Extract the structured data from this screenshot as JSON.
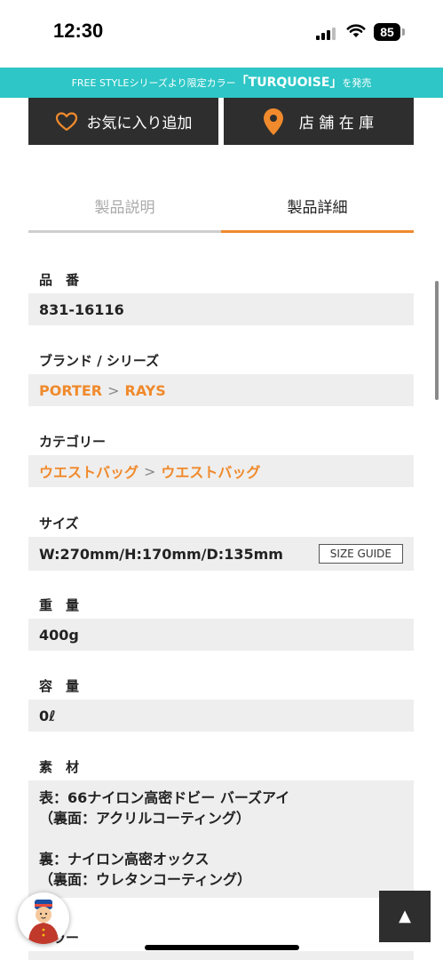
{
  "status": {
    "time": "12:30",
    "battery": "85"
  },
  "banner": {
    "prefix": "FREE STYLEシリーズより限定カラー",
    "highlight": "「TURQUOISE」",
    "suffix": "を発売",
    "color": "#2ec6c6"
  },
  "actions": {
    "favorite_label": "お気に入り追加",
    "store_label": "店 舗 在 庫",
    "accent": "#f08a2c"
  },
  "tabs": [
    {
      "label": "製品説明"
    },
    {
      "label": "製品詳細",
      "active": true
    }
  ],
  "specs": {
    "item_number": {
      "label": "品　番",
      "value": "831-16116"
    },
    "brand": {
      "label": "ブランド / シリーズ",
      "brand": "PORTER",
      "separator": ">",
      "series": "RAYS"
    },
    "category": {
      "label": "カテゴリー",
      "parent": "ウエストバッグ",
      "separator": ">",
      "child": "ウエストバッグ"
    },
    "size": {
      "label": "サイズ",
      "value": "W:270mm/H:170mm/D:135mm",
      "guide_label": "SIZE GUIDE"
    },
    "weight": {
      "label": "重　量",
      "value": "400g"
    },
    "capacity": {
      "label": "容　量",
      "value": "0ℓ"
    },
    "material": {
      "label": "素　材",
      "line1": "表：66ナイロン高密ドビー バーズアイ",
      "line2": "（裏面：アクリルコーティング）",
      "line3": "裏：ナイロン高密オックス",
      "line4": "（裏面：ウレタンコーティング）"
    },
    "next_label": "カラー"
  },
  "back_to_top": "▲"
}
